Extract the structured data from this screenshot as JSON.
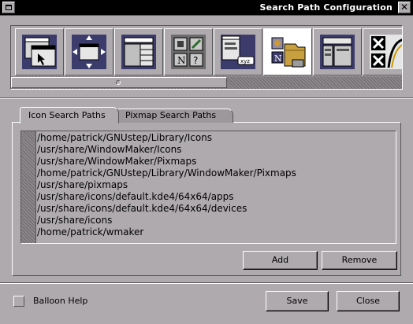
{
  "window": {
    "title": "Search Path Configuration"
  },
  "toolbar": {
    "icons": [
      {
        "name": "window-focus-prefs-icon"
      },
      {
        "name": "window-placement-prefs-icon"
      },
      {
        "name": "window-attribute-prefs-icon"
      },
      {
        "name": "menu-prefs-icon"
      },
      {
        "name": "icon-prefs-icon"
      },
      {
        "name": "search-path-prefs-icon",
        "selected": true
      },
      {
        "name": "workspace-prefs-icon"
      },
      {
        "name": "other-prefs-icon"
      }
    ]
  },
  "tabs": [
    {
      "label": "Icon Search Paths",
      "active": true
    },
    {
      "label": "Pixmap Search Paths",
      "active": false
    }
  ],
  "paths": [
    "/home/patrick/GNUstep/Library/Icons",
    "/usr/share/WindowMaker/Icons",
    "/usr/share/WindowMaker/Pixmaps",
    "/home/patrick/GNUstep/Library/WindowMaker/Pixmaps",
    "/usr/share/pixmaps",
    "/usr/share/icons/default.kde4/64x64/apps",
    "/usr/share/icons/default.kde4/64x64/devices",
    "/usr/share/icons",
    "/home/patrick/wmaker"
  ],
  "buttons": {
    "add": "Add",
    "remove": "Remove",
    "save": "Save",
    "close": "Close"
  },
  "balloon_help": {
    "label": "Balloon Help",
    "checked": false
  }
}
